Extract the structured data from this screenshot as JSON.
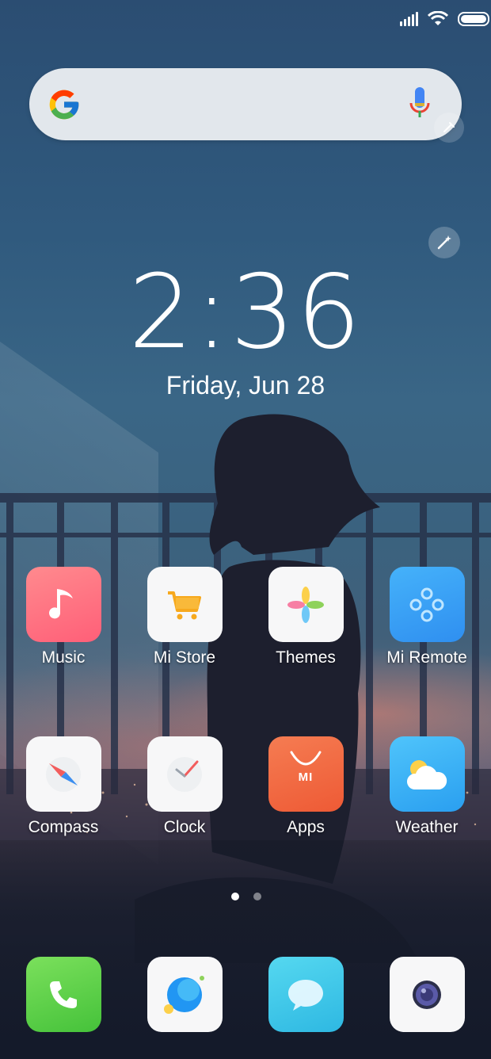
{
  "home": {
    "clock": {
      "time": "2:36",
      "date": "Friday, Jun  28"
    },
    "search": {
      "brand_icon": "google-g-icon",
      "voice_icon": "mic-icon"
    },
    "apps_row1": [
      {
        "label": "Music",
        "icon": "music-note-icon",
        "color": "#ff6f7c"
      },
      {
        "label": "Mi Store",
        "icon": "cart-icon",
        "color": "#f7a91e"
      },
      {
        "label": "Themes",
        "icon": "pinwheel-icon",
        "color": "#f7f7f8"
      },
      {
        "label": "Mi Remote",
        "icon": "remote-icon",
        "color": "#3aa5f5"
      }
    ],
    "apps_row2": [
      {
        "label": "Compass",
        "icon": "compass-icon",
        "color": "#f7f7f8"
      },
      {
        "label": "Clock",
        "icon": "clock-icon",
        "color": "#f7f7f8"
      },
      {
        "label": "Apps",
        "icon": "shopping-bag-icon",
        "color": "#f0653d",
        "badge": "MI"
      },
      {
        "label": "Weather",
        "icon": "weather-icon",
        "color": "#3bb7f4"
      }
    ],
    "dock": [
      {
        "icon": "phone-icon",
        "color": "#62d24e"
      },
      {
        "icon": "browser-icon",
        "color": "#f7f7f8"
      },
      {
        "icon": "messaging-icon",
        "color": "#38c8e8"
      },
      {
        "icon": "camera-icon",
        "color": "#f7f7f8"
      }
    ],
    "page_indicator": {
      "pages": 2,
      "active": 1
    }
  }
}
